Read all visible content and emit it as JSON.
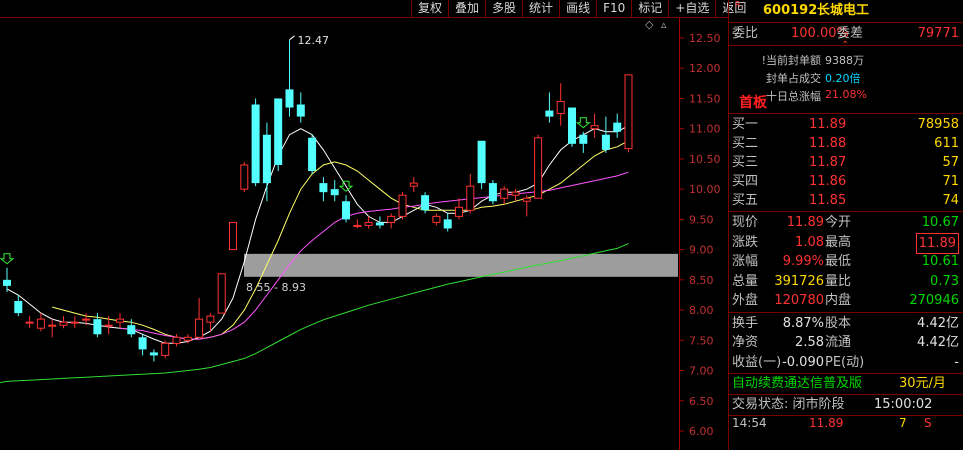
{
  "toolbar": {
    "items": [
      "复权",
      "叠加",
      "多股",
      "统计",
      "画线",
      "F10",
      "标记",
      "+自选",
      "返回"
    ]
  },
  "chart_data": {
    "type": "candlestick",
    "y_ticks": [
      "12.50",
      "12.00",
      "11.50",
      "11.00",
      "10.50",
      "10.00",
      "9.50",
      "9.00",
      "8.50",
      "8.00",
      "7.50",
      "7.00",
      "6.50",
      "6.00"
    ],
    "ylim": [
      5.9,
      12.7
    ],
    "high_label": "12.47",
    "zone_label": "8.55 - 8.93",
    "zone": [
      8.55,
      8.93
    ],
    "candles": [
      {
        "o": 8.5,
        "c": 8.4,
        "h": 8.7,
        "l": 8.3
      },
      {
        "o": 8.15,
        "c": 7.95,
        "h": 8.25,
        "l": 7.9
      },
      {
        "o": 7.8,
        "c": 7.8,
        "h": 7.9,
        "l": 7.7
      },
      {
        "o": 7.7,
        "c": 7.85,
        "h": 7.95,
        "l": 7.65
      },
      {
        "o": 7.75,
        "c": 7.75,
        "h": 7.85,
        "l": 7.55
      },
      {
        "o": 7.75,
        "c": 7.8,
        "h": 7.9,
        "l": 7.7
      },
      {
        "o": 7.8,
        "c": 7.8,
        "h": 7.9,
        "l": 7.7
      },
      {
        "o": 7.85,
        "c": 7.85,
        "h": 7.95,
        "l": 7.75
      },
      {
        "o": 7.85,
        "c": 7.6,
        "h": 7.95,
        "l": 7.55
      },
      {
        "o": 7.75,
        "c": 7.75,
        "h": 7.9,
        "l": 7.6
      },
      {
        "o": 7.8,
        "c": 7.85,
        "h": 7.95,
        "l": 7.7
      },
      {
        "o": 7.75,
        "c": 7.6,
        "h": 7.85,
        "l": 7.55
      },
      {
        "o": 7.55,
        "c": 7.35,
        "h": 7.6,
        "l": 7.25
      },
      {
        "o": 7.3,
        "c": 7.25,
        "h": 7.35,
        "l": 7.15
      },
      {
        "o": 7.25,
        "c": 7.45,
        "h": 7.5,
        "l": 7.2
      },
      {
        "o": 7.45,
        "c": 7.55,
        "h": 7.6,
        "l": 7.4
      },
      {
        "o": 7.5,
        "c": 7.55,
        "h": 7.6,
        "l": 7.45
      },
      {
        "o": 7.55,
        "c": 7.85,
        "h": 8.2,
        "l": 7.55
      },
      {
        "o": 7.8,
        "c": 7.9,
        "h": 7.95,
        "l": 7.65
      },
      {
        "o": 7.95,
        "c": 8.6,
        "h": 8.6,
        "l": 7.95
      },
      {
        "o": 9.0,
        "c": 9.45,
        "h": 9.45,
        "l": 9.0
      },
      {
        "o": 10.0,
        "c": 10.4,
        "h": 10.45,
        "l": 9.95
      },
      {
        "o": 11.4,
        "c": 10.1,
        "h": 11.5,
        "l": 10.05
      },
      {
        "o": 10.9,
        "c": 10.1,
        "h": 11.1,
        "l": 9.8
      },
      {
        "o": 11.5,
        "c": 10.4,
        "h": 11.5,
        "l": 10.3
      },
      {
        "o": 11.65,
        "c": 11.35,
        "h": 12.47,
        "l": 11.2
      },
      {
        "o": 11.4,
        "c": 11.2,
        "h": 11.6,
        "l": 11.1
      },
      {
        "o": 10.85,
        "c": 10.3,
        "h": 10.9,
        "l": 10.25
      },
      {
        "o": 10.1,
        "c": 9.95,
        "h": 10.2,
        "l": 9.8
      },
      {
        "o": 10.0,
        "c": 9.9,
        "h": 10.15,
        "l": 9.8
      },
      {
        "o": 9.8,
        "c": 9.5,
        "h": 9.9,
        "l": 9.45
      },
      {
        "o": 9.4,
        "c": 9.4,
        "h": 9.5,
        "l": 9.35
      },
      {
        "o": 9.4,
        "c": 9.45,
        "h": 9.55,
        "l": 9.35
      },
      {
        "o": 9.45,
        "c": 9.4,
        "h": 9.55,
        "l": 9.35
      },
      {
        "o": 9.45,
        "c": 9.55,
        "h": 9.6,
        "l": 9.35
      },
      {
        "o": 9.55,
        "c": 9.9,
        "h": 9.95,
        "l": 9.5
      },
      {
        "o": 10.05,
        "c": 10.1,
        "h": 10.2,
        "l": 9.95
      },
      {
        "o": 9.9,
        "c": 9.65,
        "h": 9.95,
        "l": 9.6
      },
      {
        "o": 9.45,
        "c": 9.55,
        "h": 9.6,
        "l": 9.4
      },
      {
        "o": 9.5,
        "c": 9.35,
        "h": 9.6,
        "l": 9.3
      },
      {
        "o": 9.55,
        "c": 9.7,
        "h": 9.85,
        "l": 9.5
      },
      {
        "o": 9.65,
        "c": 10.05,
        "h": 10.25,
        "l": 9.6
      },
      {
        "o": 10.8,
        "c": 10.1,
        "h": 10.8,
        "l": 10.0
      },
      {
        "o": 10.1,
        "c": 9.8,
        "h": 10.15,
        "l": 9.75
      },
      {
        "o": 9.85,
        "c": 10.0,
        "h": 10.05,
        "l": 9.75
      },
      {
        "o": 9.9,
        "c": 9.95,
        "h": 10.0,
        "l": 9.8
      },
      {
        "o": 9.8,
        "c": 9.85,
        "h": 9.9,
        "l": 9.55
      },
      {
        "o": 9.85,
        "c": 10.85,
        "h": 10.9,
        "l": 9.85
      },
      {
        "o": 11.3,
        "c": 11.2,
        "h": 11.6,
        "l": 11.1
      },
      {
        "o": 11.25,
        "c": 11.45,
        "h": 11.75,
        "l": 11.05
      },
      {
        "o": 11.35,
        "c": 10.75,
        "h": 11.35,
        "l": 10.7
      },
      {
        "o": 10.9,
        "c": 10.75,
        "h": 10.95,
        "l": 10.6
      },
      {
        "o": 11.0,
        "c": 11.05,
        "h": 11.25,
        "l": 10.85
      },
      {
        "o": 10.9,
        "c": 10.65,
        "h": 11.2,
        "l": 10.6
      },
      {
        "o": 11.1,
        "c": 10.95,
        "h": 11.25,
        "l": 10.85
      },
      {
        "o": 10.67,
        "c": 11.89,
        "h": 11.89,
        "l": 10.61
      }
    ],
    "series": [
      {
        "color": "#ffffff",
        "values": [
          8.35,
          8.25,
          8.1,
          7.95,
          7.85,
          7.8,
          7.8,
          7.78,
          7.75,
          7.72,
          7.7,
          7.68,
          7.6,
          7.52,
          7.45,
          7.45,
          7.48,
          7.55,
          7.65,
          7.85,
          8.2,
          8.8,
          9.5,
          10.05,
          10.55,
          10.9,
          11.0,
          10.9,
          10.65,
          10.35,
          10.05,
          9.75,
          9.55,
          9.45,
          9.45,
          9.55,
          9.65,
          9.75,
          9.7,
          9.6,
          9.6,
          9.65,
          9.8,
          9.9,
          9.95,
          9.95,
          10.0,
          10.1,
          10.4,
          10.65,
          10.8,
          10.9,
          11.0,
          10.95,
          10.95,
          11.05
        ]
      },
      {
        "color": "#ffff66",
        "values": [
          null,
          null,
          null,
          null,
          8.05,
          8.0,
          7.95,
          7.9,
          7.88,
          7.85,
          7.82,
          7.8,
          7.75,
          7.68,
          7.6,
          7.55,
          7.52,
          7.52,
          7.55,
          7.6,
          7.75,
          8.0,
          8.35,
          8.75,
          9.15,
          9.6,
          10.0,
          10.25,
          10.4,
          10.45,
          10.4,
          10.3,
          10.15,
          10.0,
          9.85,
          9.75,
          9.7,
          9.65,
          9.65,
          9.65,
          9.65,
          9.65,
          9.7,
          9.72,
          9.75,
          9.8,
          9.85,
          9.9,
          10.0,
          10.1,
          10.25,
          10.4,
          10.55,
          10.65,
          10.7,
          10.8
        ]
      },
      {
        "color": "#ff55ff",
        "values": [
          null,
          null,
          null,
          null,
          null,
          null,
          null,
          null,
          null,
          null,
          7.7,
          7.68,
          7.66,
          7.62,
          7.58,
          7.55,
          7.52,
          7.52,
          7.55,
          7.6,
          7.68,
          7.8,
          8.0,
          8.25,
          8.5,
          8.75,
          8.98,
          9.15,
          9.3,
          9.45,
          9.55,
          9.6,
          9.63,
          9.65,
          9.67,
          9.7,
          9.72,
          9.75,
          9.78,
          9.8,
          9.82,
          9.84,
          9.86,
          9.88,
          9.9,
          9.92,
          9.94,
          9.96,
          9.98,
          10.02,
          10.06,
          10.1,
          10.14,
          10.18,
          10.22,
          10.28
        ]
      },
      {
        "color": "#33dd33",
        "values": [
          6.82,
          6.83,
          6.84,
          6.85,
          6.86,
          6.87,
          6.88,
          6.89,
          6.9,
          6.91,
          6.92,
          6.93,
          6.94,
          6.95,
          6.96,
          6.98,
          7.0,
          7.02,
          7.05,
          7.1,
          7.15,
          7.2,
          7.28,
          7.38,
          7.48,
          7.58,
          7.68,
          7.76,
          7.84,
          7.9,
          7.96,
          8.02,
          8.08,
          8.13,
          8.18,
          8.23,
          8.28,
          8.33,
          8.38,
          8.43,
          8.47,
          8.51,
          8.55,
          8.59,
          8.63,
          8.67,
          8.71,
          8.75,
          8.78,
          8.82,
          8.86,
          8.9,
          8.94,
          8.98,
          9.02,
          9.1
        ]
      }
    ]
  },
  "stock": {
    "flag": "R",
    "code": "600192",
    "name": "长城电工"
  },
  "weibi": {
    "label1": "委比",
    "value1": "100.00%",
    "label2": "委差",
    "value2": "79771"
  },
  "seal": {
    "first_board": "首板",
    "row1_label": "当前封单额",
    "row1_value": "9388万",
    "row2_label": "封单占成交",
    "row2_value": "0.20倍",
    "row3_label": "十日总涨幅",
    "row3_value": "21.08%"
  },
  "bids": [
    {
      "label": "买一",
      "price": "11.89",
      "vol": "78958"
    },
    {
      "label": "买二",
      "price": "11.88",
      "vol": "611"
    },
    {
      "label": "买三",
      "price": "11.87",
      "vol": "57"
    },
    {
      "label": "买四",
      "price": "11.86",
      "vol": "71"
    },
    {
      "label": "买五",
      "price": "11.85",
      "vol": "74"
    }
  ],
  "stats": [
    {
      "l1": "现价",
      "v1": "11.89",
      "c1": "red",
      "l2": "今开",
      "v2": "10.67",
      "c2": "grn"
    },
    {
      "l1": "涨跌",
      "v1": "1.08",
      "c1": "red",
      "l2": "最高",
      "v2": "11.89",
      "c2": "red box"
    },
    {
      "l1": "涨幅",
      "v1": "9.99%",
      "c1": "red",
      "l2": "最低",
      "v2": "10.61",
      "c2": "grn"
    },
    {
      "l1": "总量",
      "v1": "391726",
      "c1": "yel",
      "l2": "量比",
      "v2": "0.73",
      "c2": "grn"
    },
    {
      "l1": "外盘",
      "v1": "120780",
      "c1": "red",
      "l2": "内盘",
      "v2": "270946",
      "c2": "grn"
    }
  ],
  "finance": [
    {
      "l1": "换手",
      "v1": "8.87%",
      "l2": "股本",
      "v2": "4.42亿"
    },
    {
      "l1": "净资",
      "v1": "2.58",
      "l2": "流通",
      "v2": "4.42亿"
    },
    {
      "l1": "收益(一)",
      "v1": "-0.090",
      "l2": "PE(动)",
      "v2": "-"
    }
  ],
  "ad": {
    "text": "自动续费通达信普及版",
    "price": "30元/月"
  },
  "status": {
    "label": "交易状态: 闭市阶段",
    "time": "15:00:02"
  },
  "tick": {
    "time": "14:54",
    "price": "11.89",
    "vol": "7",
    "side": "S"
  }
}
